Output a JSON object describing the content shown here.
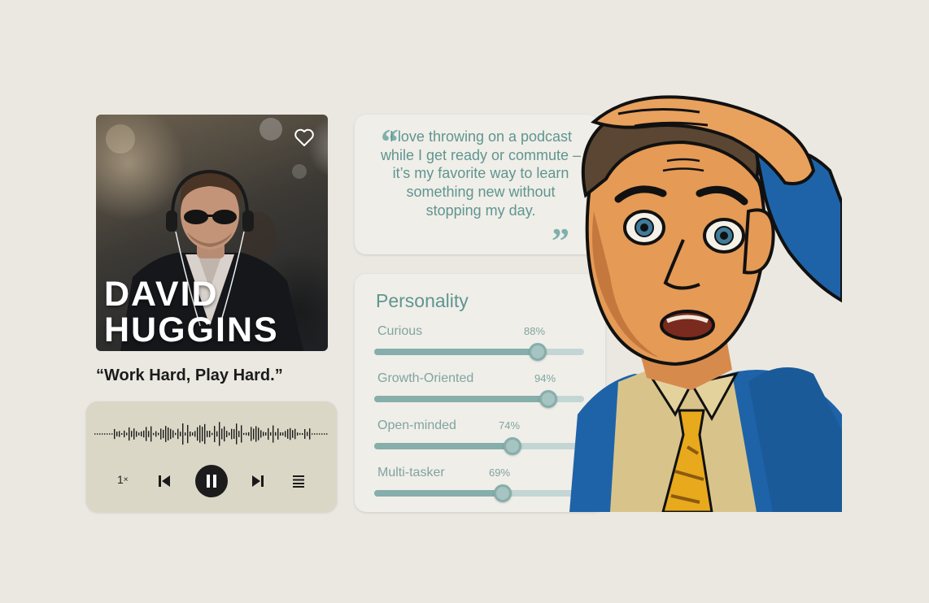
{
  "profile": {
    "first_name": "DAVID",
    "last_name": "HUGGINS",
    "motto": "“Work Hard, Play Hard.”"
  },
  "player": {
    "speed_value": "1",
    "speed_unit": "×",
    "state": "playing"
  },
  "quote": {
    "text": "I love throwing on a podcast while I get ready or commute – it’s my favorite way to learn something new without stopping my day.",
    "open_mark": "“",
    "close_mark": "”"
  },
  "personality": {
    "title": "Personality",
    "traits": [
      {
        "label": "Curious",
        "percent_label": "88%",
        "value": 0.88
      },
      {
        "label": "Growth-Oriented",
        "percent_label": "94%",
        "value": 0.94
      },
      {
        "label": "Open-minded",
        "percent_label": "74%",
        "value": 0.74
      },
      {
        "label": "Multi-tasker",
        "percent_label": "69%",
        "value": 0.69
      }
    ]
  },
  "colors": {
    "background": "#ebe8e2",
    "accent_teal": "#5f9592",
    "slider_fill": "#86aeab",
    "slider_track": "#c3d6d4",
    "player_bg": "#dad7c6"
  },
  "icons": [
    "heart-icon",
    "waveform",
    "previous-icon",
    "pause-icon",
    "next-icon",
    "queue-icon",
    "quote-icon"
  ]
}
